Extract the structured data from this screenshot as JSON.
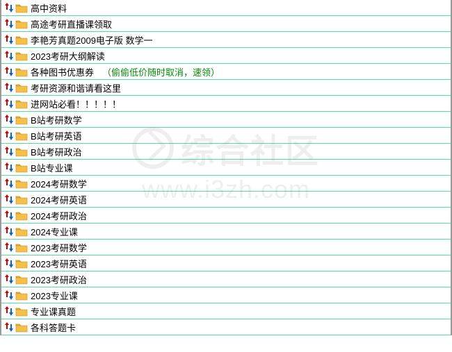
{
  "rows": [
    {
      "label": "高中资料"
    },
    {
      "label": "高途考研直播课领取"
    },
    {
      "label": "李艳芳真题2009电子版 数学一"
    },
    {
      "label": "2023考研大纲解读"
    },
    {
      "label": "各种图书优惠券",
      "note": "（偷偷低价随时取消，速领）"
    },
    {
      "label": "考研资源和谐请看这里"
    },
    {
      "label": "进网站必看！！！！！"
    },
    {
      "label": "B站考研数学"
    },
    {
      "label": "B站考研英语"
    },
    {
      "label": "B站考研政治"
    },
    {
      "label": "B站专业课"
    },
    {
      "label": "2024考研数学"
    },
    {
      "label": "2024考研英语"
    },
    {
      "label": "2024考研政治"
    },
    {
      "label": "2024专业课"
    },
    {
      "label": "2023考研数学"
    },
    {
      "label": "2023考研英语"
    },
    {
      "label": "2023考研政治"
    },
    {
      "label": "2023专业课"
    },
    {
      "label": "专业课真题"
    },
    {
      "label": "各科答题卡"
    }
  ],
  "watermark": {
    "title": "综合社区",
    "url": "www.i3zh.com"
  }
}
